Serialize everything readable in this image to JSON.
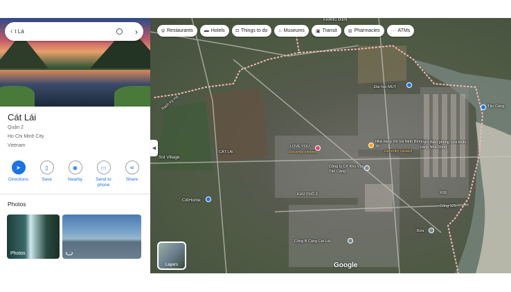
{
  "search": {
    "query": "t Lá"
  },
  "place": {
    "title": "Cát Lái",
    "address_lines": [
      "Quận 2",
      "Ho Chi Minh City",
      "Vietnam"
    ]
  },
  "actions": [
    {
      "label": "Directions",
      "icon": "directions-icon"
    },
    {
      "label": "Save",
      "icon": "bookmark-icon"
    },
    {
      "label": "Nearby",
      "icon": "nearby-icon"
    },
    {
      "label": "Send to phone",
      "icon": "phone-icon"
    },
    {
      "label": "Share",
      "icon": "share-icon"
    }
  ],
  "photos": {
    "title": "Photos",
    "items": [
      {
        "caption": "Photos"
      },
      {
        "caption": ""
      }
    ]
  },
  "chips": [
    {
      "label": "Restaurants",
      "icon": "fork-knife-icon"
    },
    {
      "label": "Hotels",
      "icon": "bed-icon"
    },
    {
      "label": "Things to do",
      "icon": "camera-icon"
    },
    {
      "label": "Museums",
      "icon": "museum-icon"
    },
    {
      "label": "Transit",
      "icon": "train-icon"
    },
    {
      "label": "Pharmacies",
      "icon": "pharmacy-icon"
    },
    {
      "label": "ATMs",
      "icon": "atm-icon"
    }
  ],
  "map_labels": {
    "khang_dien": "KHANG ĐIỀN",
    "rach_ky_ha": "Rạch Kỳ Hà",
    "dai_hoc": "Đại học MUT",
    "tan_cang": "Tân Cảng",
    "nha_hang": "Nhà hàng Dê núi Ninh Bình số 35",
    "recently_viewed_1": "Recently viewed",
    "tram_bien": "Trạm Biên phòng cửa khẩu cảng Nhà Rồng",
    "love_you": "LOVE YOU",
    "recently_viewed_2": "Recently viewed",
    "cat_lai": "CÁT LÁI",
    "cong_ty": "Công ty CP Kho Vận Tân Cảng",
    "sol_village": "Sol Village",
    "x08": "X08",
    "khu_pho": "KHU PHỐ 3",
    "cong_125": "Cổng 125",
    "city_home": "CitiHome",
    "bua": "Bửa",
    "cong_b": "Cổng B Cảng Cát Lái",
    "google": "Google",
    "layers": "Layers"
  }
}
